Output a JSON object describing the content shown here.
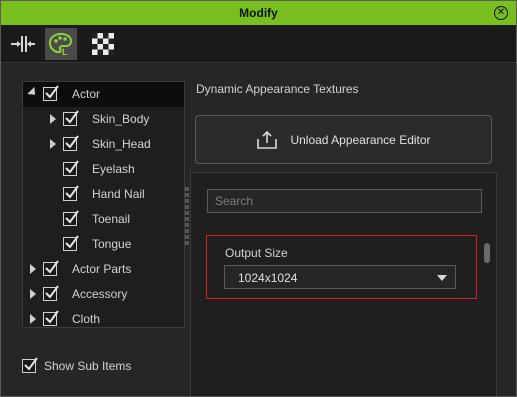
{
  "window": {
    "title": "Modify",
    "close_glyph": "✕"
  },
  "tabs": [
    {
      "icon": "align-icon"
    },
    {
      "icon": "appearance-editor-icon",
      "active": true
    },
    {
      "icon": "checker-texture-icon"
    }
  ],
  "tree": {
    "items": [
      {
        "label": "Actor",
        "expand": "expanded",
        "checked": true,
        "selected": true,
        "level": 0
      },
      {
        "label": "Skin_Body",
        "expand": "collapsed",
        "checked": true,
        "level": 1
      },
      {
        "label": "Skin_Head",
        "expand": "collapsed",
        "checked": true,
        "level": 1
      },
      {
        "label": "Eyelash",
        "expand": "none",
        "checked": true,
        "level": 1
      },
      {
        "label": "Hand Nail",
        "expand": "none",
        "checked": true,
        "level": 1
      },
      {
        "label": "Toenail",
        "expand": "none",
        "checked": true,
        "level": 1
      },
      {
        "label": "Tongue",
        "expand": "none",
        "checked": true,
        "level": 1
      },
      {
        "label": "Actor Parts",
        "expand": "collapsed",
        "checked": true,
        "level": 0
      },
      {
        "label": "Accessory",
        "expand": "collapsed",
        "checked": true,
        "level": 0
      },
      {
        "label": "Cloth",
        "expand": "collapsed",
        "checked": true,
        "level": 0
      }
    ]
  },
  "right": {
    "section_title": "Dynamic Appearance Textures",
    "unload_button": "Unload Appearance Editor",
    "search": {
      "placeholder": "Search",
      "value": ""
    },
    "output_size": {
      "label": "Output Size",
      "value": "1024x1024"
    }
  },
  "footer": {
    "show_sub_items": {
      "label": "Show Sub Items",
      "checked": true
    }
  },
  "colors": {
    "accent": "#78be1e",
    "highlight_border": "#d01f1f"
  }
}
